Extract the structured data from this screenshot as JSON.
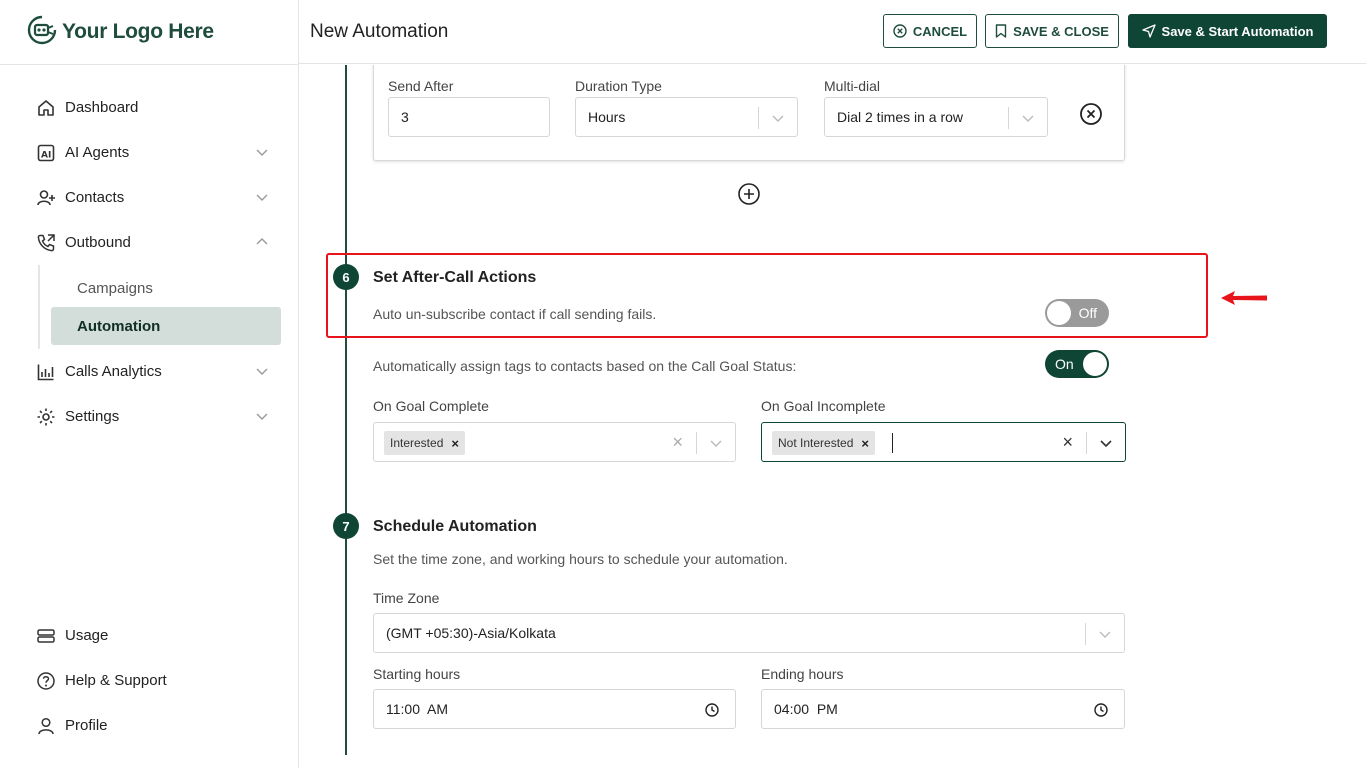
{
  "brand": {
    "logo_text": "Your Logo Here"
  },
  "header": {
    "title": "New Automation",
    "cancel_label": "CANCEL",
    "save_close_label": "SAVE & CLOSE",
    "save_start_label": "Save & Start Automation"
  },
  "sidebar": {
    "items": [
      {
        "label": "Dashboard",
        "icon": "home-icon"
      },
      {
        "label": "AI Agents",
        "icon": "ai-agents-icon"
      },
      {
        "label": "Contacts",
        "icon": "contacts-icon"
      },
      {
        "label": "Outbound",
        "icon": "phone-outbound-icon"
      },
      {
        "label": "Calls Analytics",
        "icon": "analytics-icon"
      },
      {
        "label": "Settings",
        "icon": "gear-icon"
      }
    ],
    "outbound_sub": [
      {
        "label": "Campaigns"
      },
      {
        "label": "Automation",
        "active": true
      }
    ],
    "bottom": [
      {
        "label": "Usage",
        "icon": "usage-icon"
      },
      {
        "label": "Help & Support",
        "icon": "help-icon"
      },
      {
        "label": "Profile",
        "icon": "user-icon"
      }
    ]
  },
  "retry_card": {
    "send_after_label": "Send After",
    "send_after_value": "3",
    "duration_type_label": "Duration Type",
    "duration_type_value": "Hours",
    "multi_dial_label": "Multi-dial",
    "multi_dial_value": "Dial 2 times in a row"
  },
  "step6": {
    "number": "6",
    "title": "Set After-Call Actions",
    "unsubscribe_text": "Auto un-subscribe contact if call sending fails.",
    "unsubscribe_toggle": "Off",
    "assign_tags_text": "Automatically assign tags to contacts based on the Call Goal Status:",
    "assign_tags_toggle": "On",
    "goal_complete_label": "On Goal Complete",
    "goal_complete_tag": "Interested",
    "goal_incomplete_label": "On Goal Incomplete",
    "goal_incomplete_tag": "Not Interested"
  },
  "step7": {
    "number": "7",
    "title": "Schedule Automation",
    "description": "Set the time zone, and working hours to schedule your automation.",
    "time_zone_label": "Time Zone",
    "time_zone_value": "(GMT +05:30)-Asia/Kolkata",
    "starting_hours_label": "Starting hours",
    "starting_hours_value": "11:00  AM",
    "ending_hours_label": "Ending hours",
    "ending_hours_value": "04:00  PM"
  },
  "colors": {
    "brand_dark": "#0f4534",
    "highlight_red": "#e8141b",
    "active_nav_bg": "#d3ddd9"
  }
}
